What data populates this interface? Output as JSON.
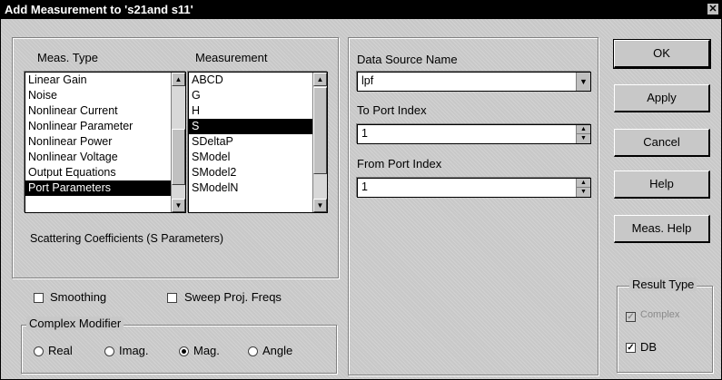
{
  "window": {
    "title": "Add Measurement to 's21and s11'"
  },
  "meas_type": {
    "label": "Meas. Type",
    "items": [
      "Linear Gain",
      "Noise",
      "Nonlinear Current",
      "Nonlinear Parameter",
      "Nonlinear Power",
      "Nonlinear Voltage",
      "Output Equations",
      "Port Parameters"
    ],
    "selected": "Port Parameters"
  },
  "measurement": {
    "label": "Measurement",
    "items": [
      "ABCD",
      "G",
      "H",
      "S",
      "SDeltaP",
      "SModel",
      "SModel2",
      "SModelN"
    ],
    "selected": "S"
  },
  "description": "Scattering Coefficients (S Parameters)",
  "data_source": {
    "label": "Data Source Name",
    "value": "lpf"
  },
  "to_port": {
    "label": "To Port Index",
    "value": "1"
  },
  "from_port": {
    "label": "From Port Index",
    "value": "1"
  },
  "options": {
    "smoothing": {
      "label": "Smoothing",
      "checked": false
    },
    "sweep_proj_freqs": {
      "label": "Sweep Proj. Freqs",
      "checked": false
    }
  },
  "complex_modifier": {
    "label": "Complex Modifier",
    "options": [
      "Real",
      "Imag.",
      "Mag.",
      "Angle"
    ],
    "selected": "Mag."
  },
  "buttons": {
    "ok": "OK",
    "apply": "Apply",
    "cancel": "Cancel",
    "help": "Help",
    "meas_help": "Meas. Help"
  },
  "result_type": {
    "label": "Result Type",
    "complex": {
      "label": "Complex",
      "checked": true,
      "enabled": false
    },
    "db": {
      "label": "DB",
      "checked": true
    }
  }
}
